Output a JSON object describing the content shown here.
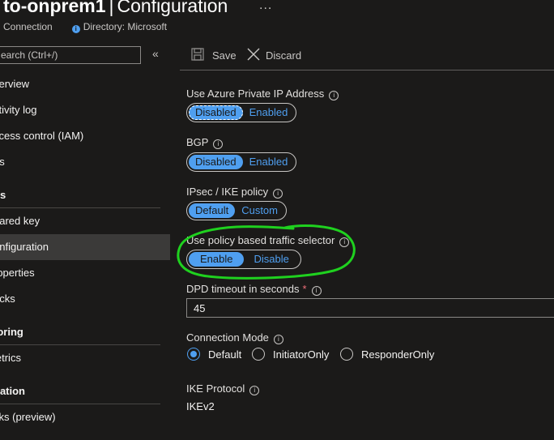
{
  "header": {
    "title_bold": "to-onprem1",
    "title_sep": "|",
    "title_rest": "Configuration",
    "more": "...",
    "subtitle_type": "Connection",
    "subtitle_directory": "Directory: Microsoft"
  },
  "sidebar": {
    "search_placeholder": "earch (Ctrl+/)",
    "collapse": "«",
    "items": [
      {
        "label": "verview"
      },
      {
        "label": "ctivity log"
      },
      {
        "label": "ccess control (IAM)"
      },
      {
        "label": "gs"
      },
      {
        "label": "hared key"
      },
      {
        "label": "onfiguration"
      },
      {
        "label": "roperties"
      },
      {
        "label": "ocks"
      },
      {
        "label": "letrics"
      },
      {
        "label": "sks (preview)"
      }
    ],
    "sections": [
      {
        "label": "gs"
      },
      {
        "label": "toring"
      },
      {
        "label": "nation"
      }
    ]
  },
  "toolbar": {
    "save_label": "Save",
    "discard_label": "Discard"
  },
  "form": {
    "private_ip": {
      "label": "Use Azure Private IP Address",
      "options": [
        "Disabled",
        "Enabled"
      ],
      "selected": "Disabled"
    },
    "bgp": {
      "label": "BGP",
      "options": [
        "Disabled",
        "Enabled"
      ],
      "selected": "Disabled"
    },
    "ipsec": {
      "label": "IPsec / IKE policy",
      "options": [
        "Default",
        "Custom"
      ],
      "selected": "Default"
    },
    "policy_selector": {
      "label": "Use policy based traffic selector",
      "options": [
        "Enable",
        "Disable"
      ],
      "selected": "Enable"
    },
    "dpd": {
      "label": "DPD timeout in seconds",
      "required_mark": "*",
      "value": "45"
    },
    "connection_mode": {
      "label": "Connection Mode",
      "options": [
        "Default",
        "InitiatorOnly",
        "ResponderOnly"
      ],
      "selected": "Default"
    },
    "ike_protocol": {
      "label": "IKE Protocol",
      "value": "IKEv2"
    }
  },
  "colors": {
    "accent": "#4f9ff0",
    "background": "#1b1a19",
    "annotation": "#1fd11f"
  },
  "icons": {
    "info": "i",
    "save": "save-icon",
    "discard": "close-icon"
  }
}
